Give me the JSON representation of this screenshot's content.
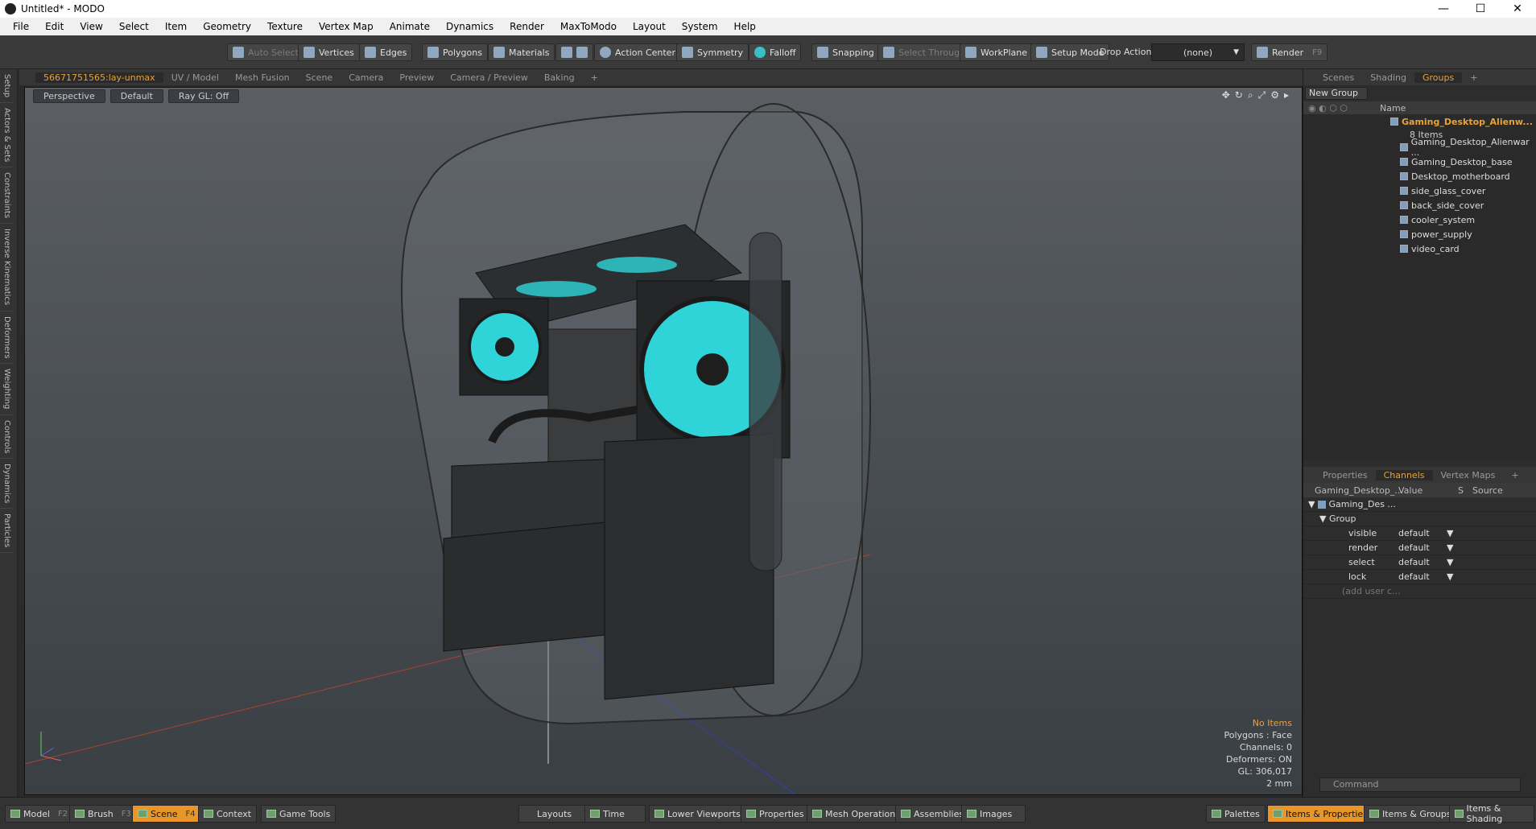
{
  "window": {
    "title": "Untitled* - MODO",
    "minimize": "—",
    "maximize": "☐",
    "close": "✕"
  },
  "menu": [
    "File",
    "Edit",
    "View",
    "Select",
    "Item",
    "Geometry",
    "Texture",
    "Vertex Map",
    "Animate",
    "Dynamics",
    "Render",
    "MaxToModo",
    "Layout",
    "System",
    "Help"
  ],
  "toolbar": {
    "auto_select": "Auto Select",
    "vertices": "Vertices",
    "edges": "Edges",
    "polygons": "Polygons",
    "materials": "Materials",
    "action_center": "Action Center",
    "symmetry": "Symmetry",
    "falloff": "Falloff",
    "snapping": "Snapping",
    "select_through": "Select Through",
    "workplane": "WorkPlane",
    "setup_mode": "Setup Mode",
    "drop_action": "Drop Action",
    "drop_value": "(none)",
    "render": "Render",
    "render_key": "F9"
  },
  "left_tabs": [
    "Setup",
    "Actors & Sets",
    "Constraints",
    "Inverse Kinematics",
    "Deformers",
    "Weighting",
    "Controls",
    "Dynamics",
    "Particles"
  ],
  "viewport_tabs": [
    "56671751565:lay-unmax",
    "UV / Model",
    "Mesh Fusion",
    "Scene",
    "Camera",
    "Preview",
    "Camera / Preview",
    "Baking",
    "+"
  ],
  "viewport": {
    "view": "Perspective",
    "shading": "Default",
    "raygl": "Ray GL: Off",
    "info": {
      "no_items": "No Items",
      "polygons": "Polygons : Face",
      "channels": "Channels: 0",
      "deformers": "Deformers: ON",
      "gl": "GL: 306,017",
      "scale": "2 mm"
    }
  },
  "scene_panel": {
    "tabs": [
      "Scenes",
      "Shading",
      "Groups",
      "+"
    ],
    "new_group": "New Group",
    "name_header": "Name",
    "group_name": "Gaming_Desktop_Alienw...",
    "group_count": "8 Items",
    "items": [
      "Gaming_Desktop_Alienwar ...",
      "Gaming_Desktop_base",
      "Desktop_motherboard",
      "side_glass_cover",
      "back_side_cover",
      "cooler_system",
      "power_supply",
      "video_card"
    ]
  },
  "properties_panel": {
    "tabs": [
      "Properties",
      "Channels",
      "Vertex Maps",
      "+"
    ],
    "col_name": "Gaming_Desktop_...",
    "col_value": "Value",
    "col_s": "S",
    "col_source": "Source",
    "root": "Gaming_Des ...",
    "group": "Group",
    "rows": [
      {
        "name": "visible",
        "value": "default"
      },
      {
        "name": "render",
        "value": "default"
      },
      {
        "name": "select",
        "value": "default"
      },
      {
        "name": "lock",
        "value": "default"
      }
    ],
    "add_user": "(add user c...",
    "command_placeholder": "Command"
  },
  "bottom": {
    "model": "Model",
    "model_key": "F2",
    "brush": "Brush",
    "brush_key": "F3",
    "scene": "Scene",
    "scene_key": "F4",
    "context": "Context",
    "game_tools": "Game Tools",
    "layouts": "Layouts",
    "time": "Time",
    "lower_viewports": "Lower Viewports",
    "properties": "Properties",
    "mesh_operations": "Mesh Operations",
    "assemblies": "Assemblies",
    "images": "Images",
    "palettes": "Palettes",
    "items_properties": "Items & Properties",
    "items_groups": "Items & Groups",
    "items_shading": "Items & Shading"
  },
  "colors": {
    "accent": "#e8a23a",
    "cyan_fan": "#2fd4d8"
  }
}
